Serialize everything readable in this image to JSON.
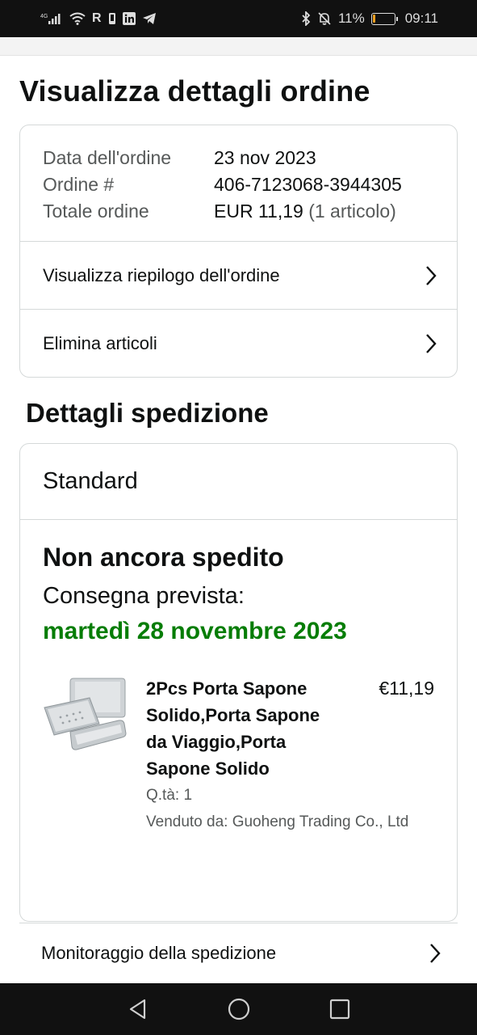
{
  "status_bar": {
    "network_label": "4G",
    "roaming_label": "R",
    "battery_percent": "11%",
    "battery_level": 0.11,
    "time": "09:11",
    "icons": [
      "signal-icon",
      "wifi-icon",
      "roaming-icon",
      "phone-icon",
      "linkedin-icon",
      "telegram-icon",
      "bluetooth-icon",
      "mute-icon",
      "battery-icon"
    ]
  },
  "page": {
    "title": "Visualizza dettagli ordine"
  },
  "order_summary": {
    "rows": [
      {
        "key": "Data dell'ordine",
        "value": "23 nov 2023",
        "extra": ""
      },
      {
        "key": "Ordine #",
        "value": "406-7123068-3944305",
        "extra": ""
      },
      {
        "key": "Totale ordine",
        "value": "EUR 11,19",
        "extra": " (1 articolo)"
      }
    ],
    "links": [
      {
        "label": "Visualizza riepilogo dell'ordine"
      },
      {
        "label": "Elimina articoli"
      }
    ]
  },
  "shipping": {
    "section_title": "Dettagli spedizione",
    "type": "Standard",
    "status": "Non ancora spedito",
    "eta_label": "Consegna prevista:",
    "eta_date": "martedì 28 novembre 2023",
    "item": {
      "title": "2Pcs Porta Sapone Solido,Porta Sapone da Viaggio,Porta Sapone Solido",
      "price": "€11,19",
      "quantity": "Q.tà: 1",
      "seller": "Venduto da: Guoheng Trading Co., Ltd"
    },
    "tracking_label": "Monitoraggio della spedizione"
  },
  "colors": {
    "eta_green": "#067d06",
    "border": "#d5d9d9",
    "muted_text": "#565959",
    "battery_fill": "#f0a020"
  },
  "nav": {
    "icons": [
      "back-icon",
      "home-icon",
      "recents-icon"
    ]
  }
}
